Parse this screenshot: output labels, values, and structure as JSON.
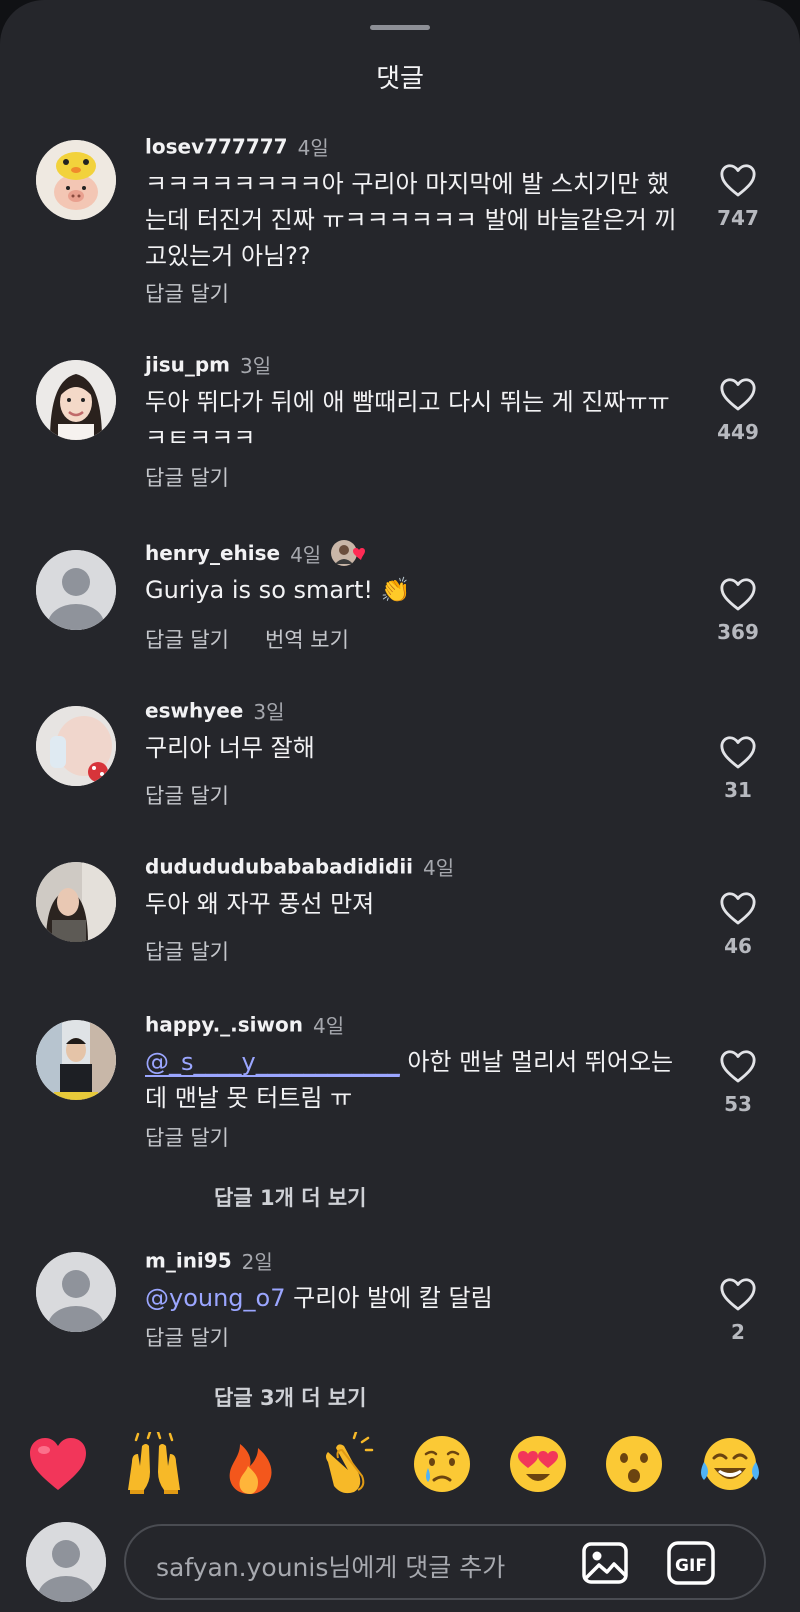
{
  "sheet": {
    "title": "댓글"
  },
  "comments": [
    {
      "username": "losev777777",
      "time": "4일",
      "text": "ㅋㅋㅋㅋㅋㅋㅋㅋ아 구리아 마지막에 발 스치기만 했는데 터진거 진짜 ㅠㅋㅋㅋㅋㅋㅋ 발에 바늘같은거 끼고있는거 아님??",
      "reply_label": "답글 달기",
      "likes": "747",
      "avatar": "chick-hat-avatar"
    },
    {
      "username": "jisu_pm",
      "time": "3일",
      "text": "두아 뛰다가 뒤에 애 빰때리고 다시 뛰는 게 진짜ㅠㅠㅋㅌㅋㅋㅋ",
      "reply_label": "답글 달기",
      "likes": "449",
      "avatar": "woman-photo-avatar"
    },
    {
      "username": "henry_ehise",
      "time": "4일",
      "text": "Guriya is so smart! 👏",
      "reply_label": "답글 달기",
      "translate_label": "번역 보기",
      "likes": "369",
      "avatar": "default-avatar",
      "badge": "creator-liked-heart-badge"
    },
    {
      "username": "eswhyee",
      "time": "3일",
      "text": "구리아 너무 잘해",
      "reply_label": "답글 달기",
      "likes": "31",
      "avatar": "baby-photo-avatar"
    },
    {
      "username": "dudududubababadididii",
      "time": "4일",
      "text": "두아 왜 자꾸 풍선 만져",
      "reply_label": "답글 달기",
      "likes": "46",
      "avatar": "person-photo-avatar"
    },
    {
      "username": "happy._.siwon",
      "time": "4일",
      "mention": "@_s____y____________",
      "text": " 아한 맨날 멀리서 뛰어오는데 맨날 못 터트림 ㅠ",
      "reply_label": "답글 달기",
      "likes": "53",
      "avatar": "man-photo-avatar",
      "more_replies": "답글 1개 더 보기"
    },
    {
      "username": "m_ini95",
      "time": "2일",
      "mention": "@young_o7",
      "text": " 구리아 발에 칼 달림",
      "reply_label": "답글 달기",
      "likes": "2",
      "avatar": "default-avatar",
      "more_replies": "답글 3개 더 보기"
    }
  ],
  "emoji_bar": [
    "heart",
    "raised-hands",
    "fire",
    "clapping-hands",
    "crying-face",
    "heart-eyes",
    "surprised-face",
    "tears-of-joy"
  ],
  "composer": {
    "placeholder": "safyan.younis님에게 댓글 추가",
    "gif_label": "GIF"
  },
  "colors": {
    "background": "#25262b",
    "text": "#f2f2f4",
    "muted": "#a5a7ad",
    "mention": "#9ba6ff"
  }
}
